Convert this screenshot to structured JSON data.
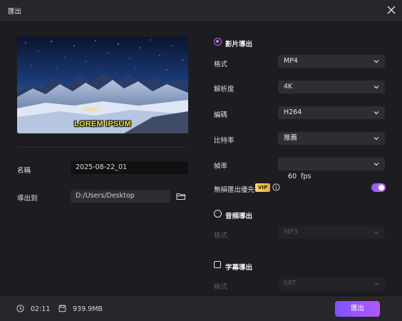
{
  "window": {
    "title": "匯出"
  },
  "preview": {
    "caption": "LOREM IPSUM"
  },
  "left": {
    "name_label": "名稱",
    "name_value": "2025-08-22_01",
    "export_to_label": "導出到",
    "export_path": "D:/Users/Desktop"
  },
  "video_export": {
    "label": "影片導出",
    "selected": true,
    "fields": [
      {
        "label": "格式",
        "value": "MP4"
      },
      {
        "label": "解析度",
        "value": "4K"
      },
      {
        "label": "編碼",
        "value": "H264"
      },
      {
        "label": "比特率",
        "value": "推薦"
      },
      {
        "label": "幀率",
        "value": "60  fps"
      }
    ],
    "lossless": {
      "label": "無損匯出優先",
      "badge": "VIP",
      "enabled": true
    }
  },
  "audio_export": {
    "label": "音頻導出",
    "selected": false,
    "format_label": "格式",
    "format_value": "MP3"
  },
  "subtitle_export": {
    "label": "字幕導出",
    "checked": false,
    "format_label": "格式",
    "format_value": "SRT"
  },
  "footer": {
    "duration": "02:11",
    "size": "939.9MB",
    "export_button": "匯出"
  },
  "colors": {
    "accent": "#b36bff",
    "button_gradient_start": "#7b55ff",
    "button_gradient_end": "#b457ff"
  }
}
